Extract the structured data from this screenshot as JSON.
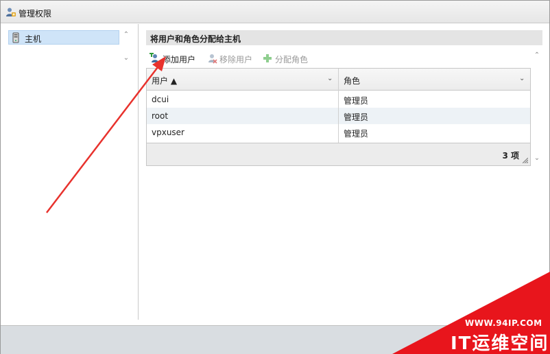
{
  "window": {
    "title": "管理权限"
  },
  "tree": {
    "items": [
      {
        "label": "主机",
        "selected": true
      }
    ]
  },
  "panel": {
    "header": "将用户和角色分配给主机"
  },
  "toolbar": {
    "add_user": "添加用户",
    "remove_user": "移除用户",
    "assign_role": "分配角色"
  },
  "grid": {
    "columns": [
      {
        "label": "用户 ▲",
        "sorted": "asc"
      },
      {
        "label": "角色"
      }
    ],
    "rows": [
      {
        "user": "dcui",
        "role": "管理员"
      },
      {
        "user": "root",
        "role": "管理员"
      },
      {
        "user": "vpxuser",
        "role": "管理员"
      }
    ],
    "count_label": "3 项"
  },
  "watermark": {
    "url": "WWW.94IP.COM",
    "name": "IT运维空间",
    "color": "#e8151c"
  },
  "annotation": {
    "arrow_color": "#e8322d"
  }
}
